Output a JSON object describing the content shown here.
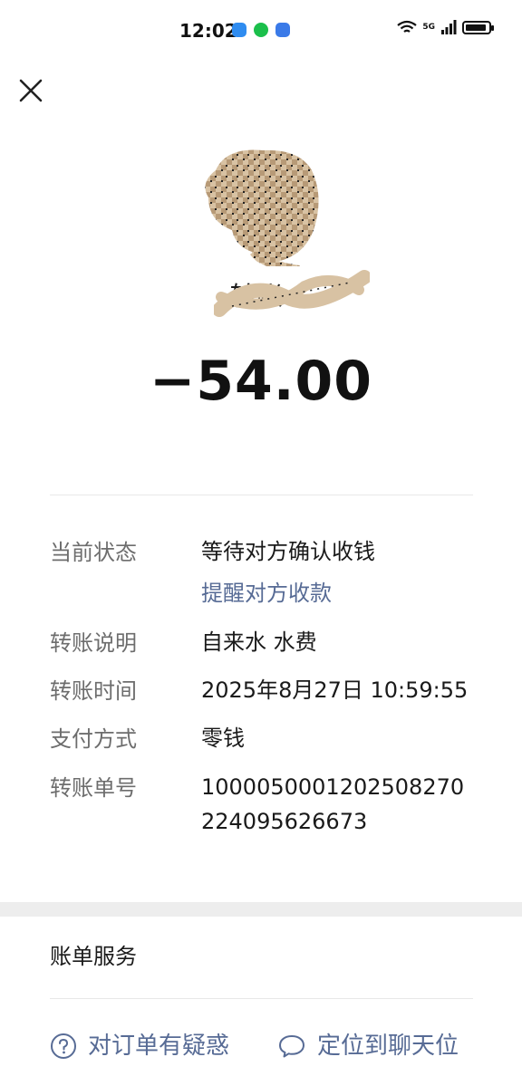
{
  "status_bar": {
    "time": "12:02",
    "network_label": "5G",
    "app_icon_colors": [
      "#2f8cf0",
      "#1bbf4b",
      "#3a7ae8"
    ]
  },
  "header": {
    "close_icon": "close-icon"
  },
  "payee": {
    "title": "转账-"
  },
  "amount": "−54.00",
  "details": {
    "status_label": "当前状态",
    "status_value": "等待对方确认收钱",
    "remind_link": "提醒对方收款",
    "note_label": "转账说明",
    "note_value": "自来水 水费",
    "time_label": "转账时间",
    "time_value": "2025年8月27日 10:59:55",
    "method_label": "支付方式",
    "method_value": "零钱",
    "order_label": "转账单号",
    "order_line1": "1000050001202508270",
    "order_line2": "224095626673"
  },
  "services": {
    "title": "账单服务",
    "question": {
      "label": "对订单有疑惑",
      "icon": "question-circle-icon"
    },
    "locate": {
      "label": "定位到聊天位",
      "icon": "chat-bubble-icon"
    }
  },
  "colors": {
    "link": "#576b95",
    "divider_band": "#ededed"
  }
}
